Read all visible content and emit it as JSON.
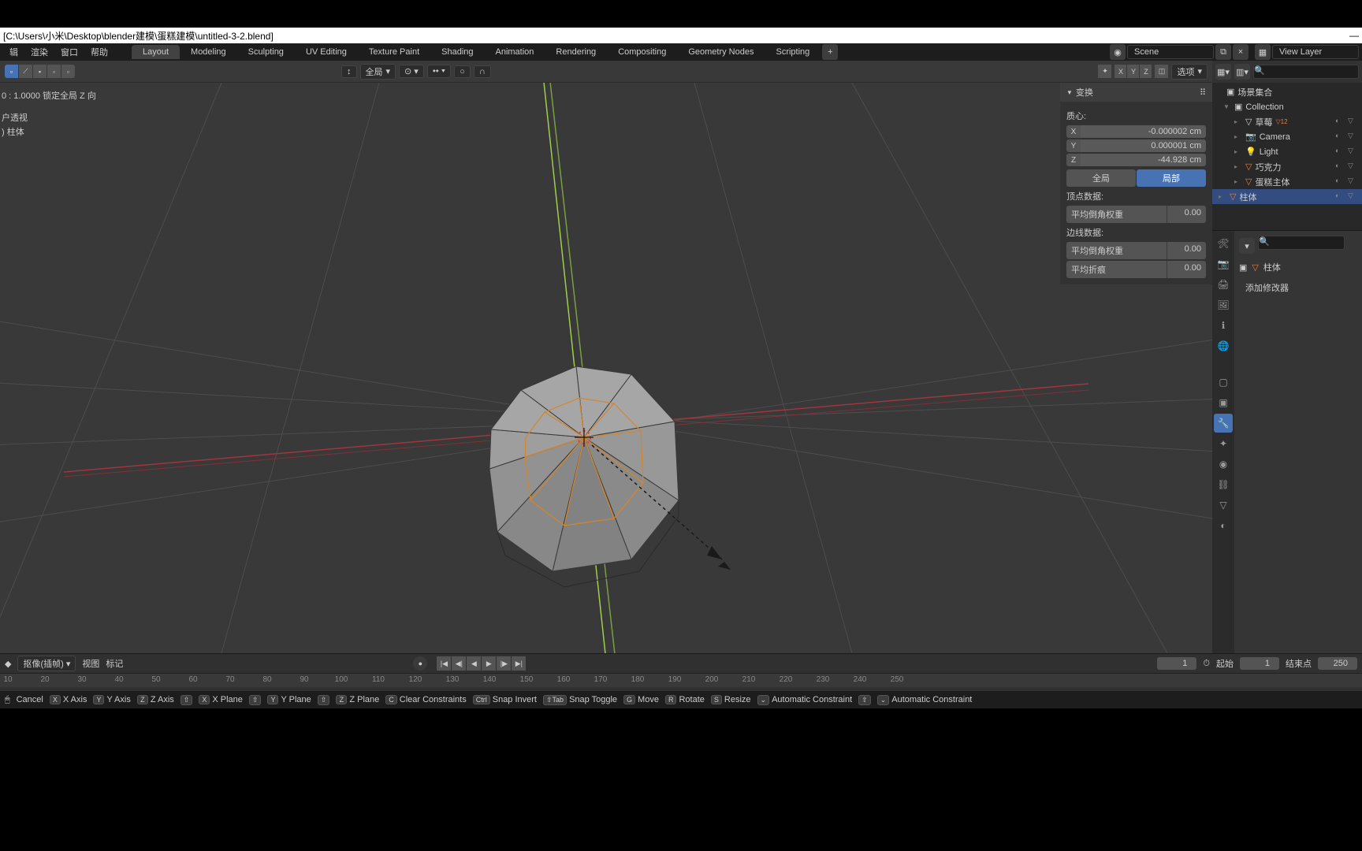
{
  "title": "[C:\\Users\\小米\\Desktop\\blender建模\\蛋糕建模\\untitled-3-2.blend]",
  "menus": [
    "辑",
    "渲染",
    "窗口",
    "帮助"
  ],
  "workspaces": [
    "Layout",
    "Modeling",
    "Sculpting",
    "UV Editing",
    "Texture Paint",
    "Shading",
    "Animation",
    "Rendering",
    "Compositing",
    "Geometry Nodes",
    "Scripting"
  ],
  "active_ws": "Layout",
  "scene": "Scene",
  "viewlayer": "View Layer",
  "vp_orient": "全局",
  "vp_opts": "选项",
  "info_line1": "0 : 1.0000 锁定全局 Z 向",
  "info_line2": "户透视",
  "info_line3": ") 柱体",
  "transform": {
    "header": "变换",
    "origin": "质心:",
    "x": "-0.000002 cm",
    "y": "0.000001 cm",
    "z": "-44.928 cm",
    "global": "全局",
    "local": "局部"
  },
  "vertdata": {
    "label": "顶点数据:",
    "bevel": "平均倒角权重",
    "bevelval": "0.00"
  },
  "edgedata": {
    "label": "边线数据:",
    "bevel": "平均倒角权重",
    "bevelval": "0.00",
    "crease": "平均折痕",
    "creaseval": "0.00"
  },
  "outliner": {
    "scene": "场景集合",
    "coll": "Collection",
    "items": [
      "草莓",
      "Camera",
      "Light",
      "巧克力",
      "蛋糕主体",
      "柱体"
    ],
    "badge": "12"
  },
  "props": {
    "obj": "柱体",
    "addmod": "添加修改器"
  },
  "timeline": {
    "mode": "抠像(插帧)",
    "view": "视图",
    "marker": "标记",
    "cur": "1",
    "start": "起始",
    "startval": "1",
    "end": "结束点",
    "endval": "250"
  },
  "ruler": [
    10,
    20,
    30,
    40,
    50,
    60,
    70,
    80,
    90,
    100,
    110,
    120,
    130,
    140,
    150,
    160,
    170,
    180,
    190,
    200,
    210,
    220,
    230,
    240,
    250
  ],
  "hints": [
    {
      "k": "",
      "t": "Cancel"
    },
    {
      "k": "X",
      "t": "X Axis"
    },
    {
      "k": "Y",
      "t": "Y Axis"
    },
    {
      "k": "Z",
      "t": "Z Axis"
    },
    {
      "k": "⇧",
      "t": ""
    },
    {
      "k": "X",
      "t": "X Plane"
    },
    {
      "k": "⇧",
      "t": ""
    },
    {
      "k": "Y",
      "t": "Y Plane"
    },
    {
      "k": "⇧",
      "t": ""
    },
    {
      "k": "Z",
      "t": "Z Plane"
    },
    {
      "k": "C",
      "t": "Clear Constraints"
    },
    {
      "k": "Ctrl",
      "t": "Snap Invert"
    },
    {
      "k": "⇧Tab",
      "t": "Snap Toggle"
    },
    {
      "k": "G",
      "t": "Move"
    },
    {
      "k": "R",
      "t": "Rotate"
    },
    {
      "k": "S",
      "t": "Resize"
    },
    {
      "k": "⌄",
      "t": "Automatic Constraint"
    },
    {
      "k": "⇧",
      "t": ""
    },
    {
      "k": "⌄",
      "t": "Automatic Constraint"
    }
  ]
}
